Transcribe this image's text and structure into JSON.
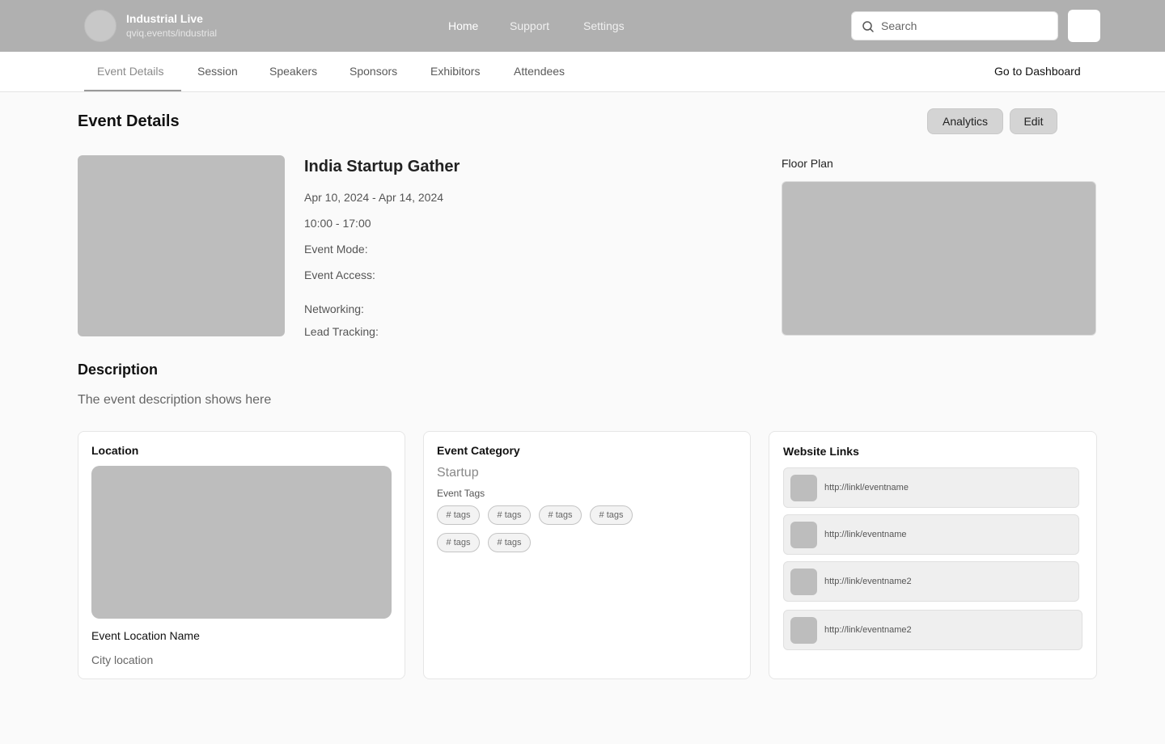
{
  "brand": {
    "title": "Industrial Live",
    "subtitle": "qviq.events/industrial"
  },
  "top_nav": [
    "Home",
    "Support",
    "Settings"
  ],
  "search": {
    "placeholder": "Search"
  },
  "tabs": [
    "Event Details",
    "Session",
    "Speakers",
    "Sponsors",
    "Exhibitors",
    "Attendees"
  ],
  "dashboard_link": "Go to Dashboard",
  "page": {
    "title": "Event Details",
    "analytics_label": "Analytics",
    "edit_label": "Edit"
  },
  "event": {
    "name": "India Startup Gather",
    "dates": "Apr 10, 2024 - Apr 14, 2024",
    "time": "10:00 - 17:00",
    "mode_label": "Event Mode:",
    "access_label": "Event Access:",
    "networking_label": "Networking:",
    "lead_tracking_label": "Lead Tracking:"
  },
  "floor_plan": {
    "label": "Floor Plan"
  },
  "description": {
    "title": "Description",
    "text": "The event description shows here"
  },
  "location": {
    "title": "Location",
    "name": "Event Location Name",
    "city": "City location"
  },
  "category": {
    "title": "Event Category",
    "value": "Startup",
    "tags_label": "Event Tags",
    "tags": [
      "# tags",
      "# tags",
      "# tags",
      "# tags",
      "# tags",
      "# tags"
    ]
  },
  "website_links": {
    "title": "Website Links",
    "links": [
      "http://linkl/eventname",
      "http://link/eventname",
      "http://link/eventname2",
      "http://link/eventname2"
    ]
  }
}
